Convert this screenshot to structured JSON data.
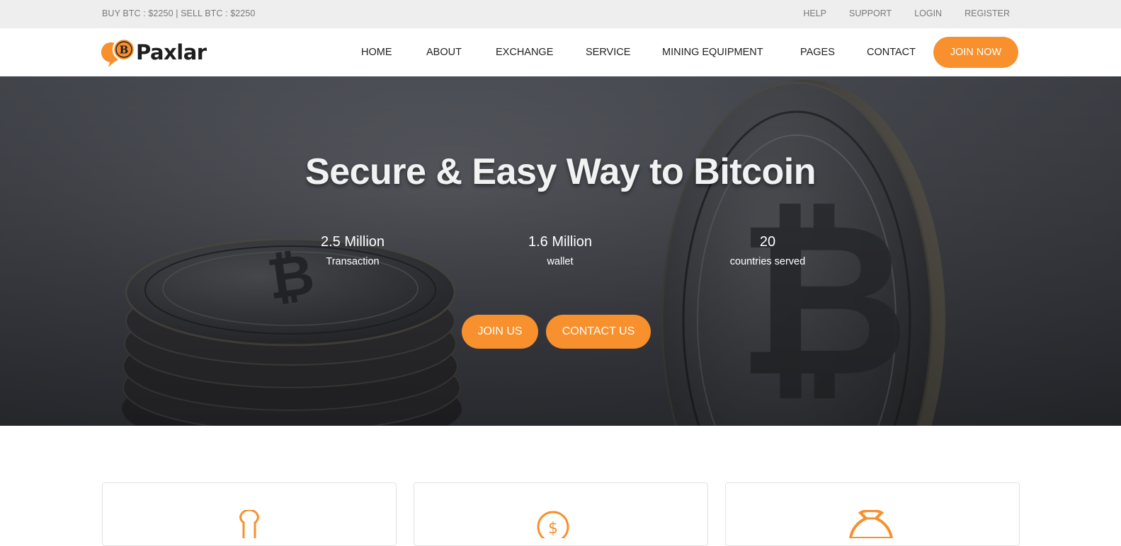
{
  "topbar": {
    "ticker": "BUY BTC : $2250 | SELL BTC : $2250",
    "links": [
      "HELP",
      "SUPPORT",
      "LOGIN",
      "REGISTER"
    ]
  },
  "brand": {
    "name": "Paxlar",
    "logo_letter": "B"
  },
  "nav": {
    "items": [
      "HOME",
      "ABOUT",
      "EXCHANGE",
      "SERVICE",
      "MINING EQUIPMENT",
      "PAGES",
      "CONTACT"
    ],
    "cta": "JOIN NOW"
  },
  "hero": {
    "title": "Secure & Easy Way to Bitcoin",
    "stats": [
      {
        "value": "2.5 Million",
        "label": "Transaction"
      },
      {
        "value": "1.6 Million",
        "label": "wallet"
      },
      {
        "value": "20",
        "label": "countries served"
      }
    ],
    "buttons": [
      "JOIN US",
      "CONTACT US"
    ]
  },
  "features": {
    "icons": [
      "lightbulb-icon",
      "dollar-coin-icon",
      "money-bag-icon"
    ]
  },
  "colors": {
    "accent": "#f7902d",
    "topbar": "#eeeeee",
    "text": "#222222"
  }
}
